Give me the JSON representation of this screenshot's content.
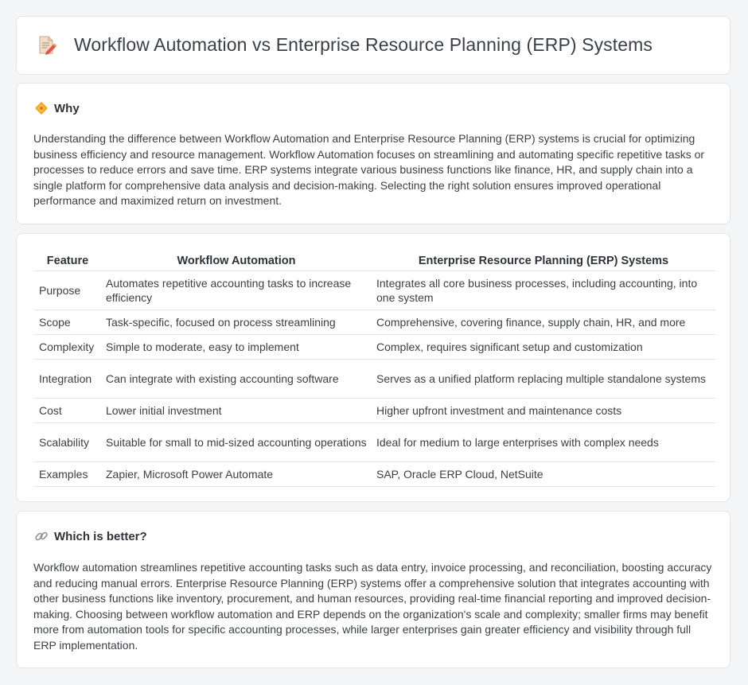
{
  "header": {
    "title": "Workflow Automation vs Enterprise Resource Planning (ERP) Systems",
    "icon": "document-edit-icon"
  },
  "why": {
    "title": "Why",
    "icon": "diamond-icon",
    "text": "Understanding the difference between Workflow Automation and Enterprise Resource Planning (ERP) systems is crucial for optimizing business efficiency and resource management. Workflow Automation focuses on streamlining and automating specific repetitive tasks or processes to reduce errors and save time. ERP systems integrate various business functions like finance, HR, and supply chain into a single platform for comprehensive data analysis and decision-making. Selecting the right solution ensures improved operational performance and maximized return on investment."
  },
  "comparison": {
    "headers": [
      "Feature",
      "Workflow Automation",
      "Enterprise Resource Planning (ERP) Systems"
    ],
    "rows": [
      [
        "Purpose",
        "Automates repetitive accounting tasks to increase efficiency",
        "Integrates all core business processes, including accounting, into one system"
      ],
      [
        "Scope",
        "Task-specific, focused on process streamlining",
        "Comprehensive, covering finance, supply chain, HR, and more"
      ],
      [
        "Complexity",
        "Simple to moderate, easy to implement",
        "Complex, requires significant setup and customization"
      ],
      [
        "Integration",
        "Can integrate with existing accounting software",
        "Serves as a unified platform replacing multiple standalone systems"
      ],
      [
        "Cost",
        "Lower initial investment",
        "Higher upfront investment and maintenance costs"
      ],
      [
        "Scalability",
        "Suitable for small to mid-sized accounting operations",
        "Ideal for medium to large enterprises with complex needs"
      ],
      [
        "Examples",
        "Zapier, Microsoft Power Automate",
        "SAP, Oracle ERP Cloud, NetSuite"
      ]
    ]
  },
  "better": {
    "title": "Which is better?",
    "icon": "link-icon",
    "text": "Workflow automation streamlines repetitive accounting tasks such as data entry, invoice processing, and reconciliation, boosting accuracy and reducing manual errors. Enterprise Resource Planning (ERP) systems offer a comprehensive solution that integrates accounting with other business functions like inventory, procurement, and human resources, providing real-time financial reporting and improved decision-making. Choosing between workflow automation and ERP depends on the organization's scale and complexity; smaller firms may benefit more from automation tools for specific accounting processes, while larger enterprises gain greater efficiency and visibility through full ERP implementation."
  }
}
